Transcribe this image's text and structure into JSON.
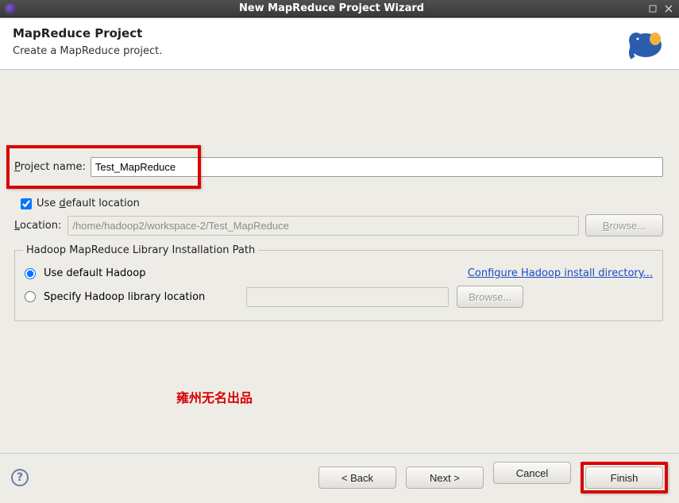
{
  "window": {
    "title": "New MapReduce Project Wizard"
  },
  "header": {
    "title": "MapReduce Project",
    "desc": "Create a MapReduce project."
  },
  "form": {
    "project_name_label_pre": "P",
    "project_name_label_post": "roject name:",
    "project_name_value": "Test_MapReduce",
    "use_default_location_pre": "Use ",
    "use_default_location_ul": "d",
    "use_default_location_post": "efault location",
    "use_default_location_checked": "true",
    "location_label_ul": "L",
    "location_label_post": "ocation:",
    "location_value": "/home/hadoop2/workspace-2/Test_MapReduce",
    "browse_label_ul": "B",
    "browse_label_post": "rowse..."
  },
  "hadoop": {
    "legend": "Hadoop MapReduce Library Installation Path",
    "use_default_label": "Use default Hadoop",
    "configure_link": "Configure Hadoop install directory...",
    "specify_label": "Specify Hadoop library location",
    "specify_value": "",
    "browse2_label": "Browse..."
  },
  "watermark": "雍州无名出品",
  "footer": {
    "back": "< Back",
    "next": "Next >",
    "cancel": "Cancel",
    "finish": "Finish"
  }
}
